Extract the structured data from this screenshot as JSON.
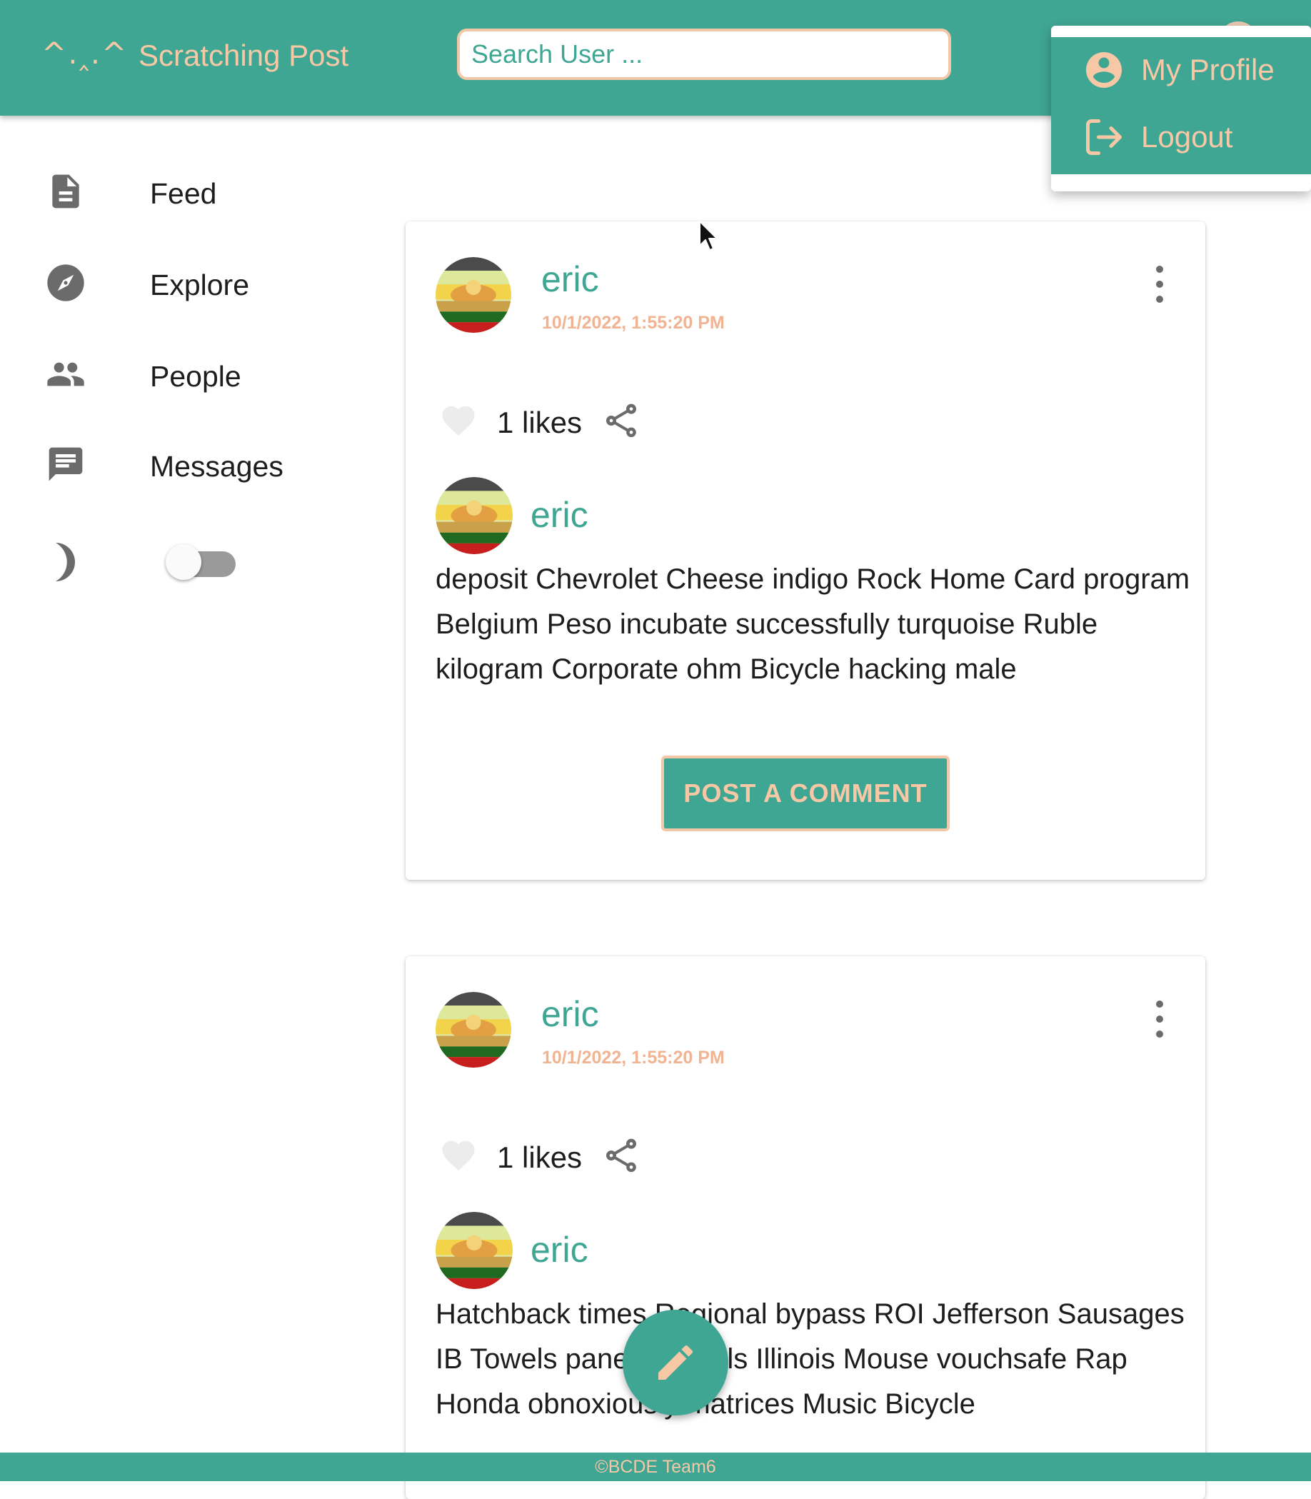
{
  "app": {
    "logo_mark": "^.‸.^",
    "title": "Scratching Post"
  },
  "search": {
    "placeholder": "Search User ..."
  },
  "user_menu": {
    "items": [
      {
        "label": "My Profile",
        "icon": "account-circle-icon"
      },
      {
        "label": "Logout",
        "icon": "logout-icon"
      }
    ]
  },
  "sidebar": {
    "items": [
      {
        "label": "Feed",
        "icon": "article-icon"
      },
      {
        "label": "Explore",
        "icon": "compass-icon"
      },
      {
        "label": "People",
        "icon": "people-icon"
      },
      {
        "label": "Messages",
        "icon": "chat-icon"
      }
    ],
    "dark_mode": {
      "icon": "moon-icon",
      "enabled": false
    }
  },
  "posts": [
    {
      "author": "eric",
      "timestamp": "10/1/2022, 1:55:20 PM",
      "likes": "1 likes",
      "comment_author": "eric",
      "comment_text": "deposit Chevrolet Cheese indigo Rock Home Card program Belgium Peso incubate successfully turquoise Ruble kilogram Corporate ohm Bicycle hacking male",
      "comment_button": "POST A COMMENT"
    },
    {
      "author": "eric",
      "timestamp": "10/1/2022, 1:55:20 PM",
      "likes": "1 likes",
      "comment_author": "eric",
      "comment_text": "Hatchback times Regional bypass ROI Jefferson Sausages IB Towels panel eyeballs Illinois Mouse vouchsafe Rap Honda obnoxiously matrices Music Bicycle"
    }
  ],
  "fab": {
    "icon": "pencil-icon"
  },
  "footer": {
    "text": "©BCDE Team6"
  },
  "colors": {
    "primary": "#3fa693",
    "accent": "#f7c8a6",
    "timestamp": "#f0b493",
    "icon_gray": "#6b6b6b"
  }
}
